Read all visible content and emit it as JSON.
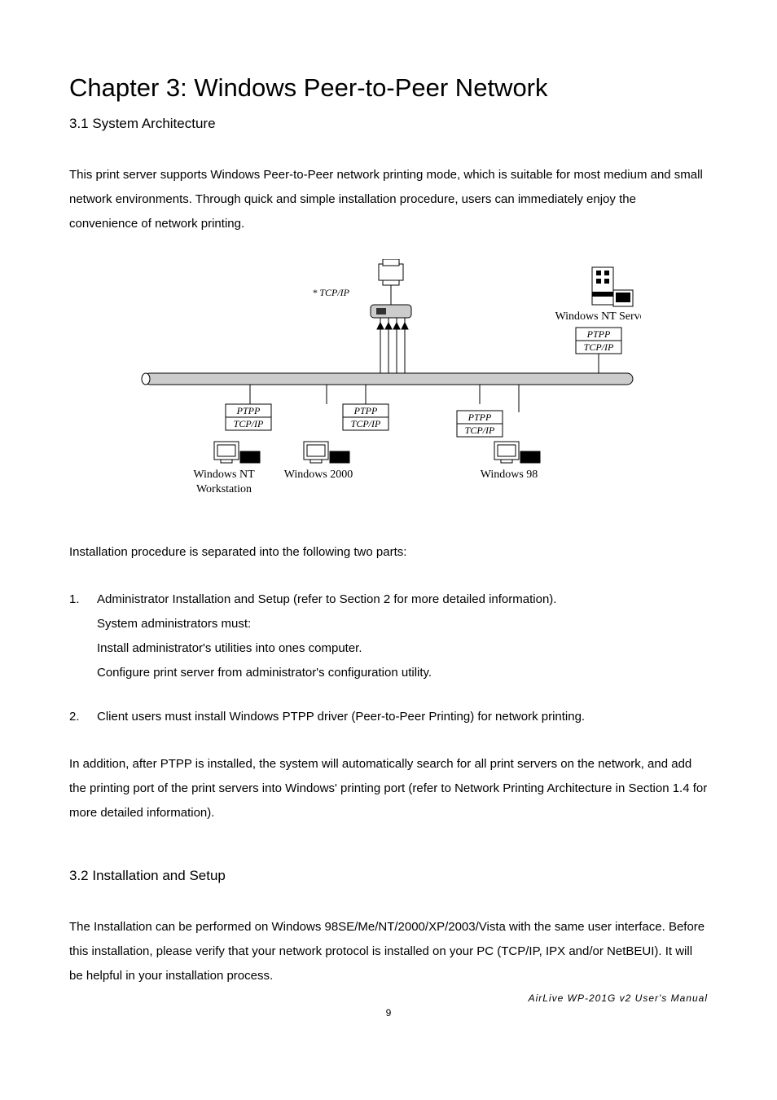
{
  "chapter_title": "Chapter 3: Windows Peer-to-Peer Network",
  "section_1_heading": "3.1 System Architecture",
  "para_1": "This print server supports Windows Peer-to-Peer network printing mode, which is suitable for most medium and small network environments. Through quick and simple installation procedure, users can immediately enjoy the convenience of network printing.",
  "diagram": {
    "tcpip_label": "* TCP/IP",
    "server_label": "Windows NT Server",
    "server_box_ptpp": "PTPP",
    "server_box_tcpip": "TCP/IP",
    "client1_box_ptpp": "PTPP",
    "client1_box_tcpip": "TCP/IP",
    "client1_label_l1": "Windows NT",
    "client1_label_l2": "Workstation",
    "client2_box_ptpp": "PTPP",
    "client2_box_tcpip": "TCP/IP",
    "client2_label": "Windows 2000",
    "client3_box_ptpp": "PTPP",
    "client3_box_tcpip": "TCP/IP",
    "client3_label": "Windows 98"
  },
  "para_2": "Installation procedure is separated into the following two parts:",
  "list": {
    "item1_marker": "1.",
    "item1_line1": "Administrator Installation and Setup (refer to Section 2 for more detailed information).",
    "item1_line2": "System administrators must:",
    "item1_line3": "Install administrator's utilities into ones computer.",
    "item1_line4": "Configure print server from administrator's configuration utility.",
    "item2_marker": "2.",
    "item2_line1": "Client users must install Windows PTPP driver (Peer-to-Peer Printing) for network printing."
  },
  "para_3": "In addition, after PTPP is installed, the system will automatically search for all print servers on the network, and add the printing port of the print servers into Windows' printing port (refer to Network Printing Architecture in Section 1.4 for more detailed information).",
  "section_2_heading": "3.2 Installation and Setup",
  "para_4": "The Installation can be performed on Windows 98SE/Me/NT/2000/XP/2003/Vista with the same user interface. Before this installation, please verify that your network protocol is installed on your PC (TCP/IP, IPX and/or NetBEUI). It will be helpful in your installation process.",
  "footer_doc": "AirLive WP-201G v2 User's Manual",
  "footer_page": "9"
}
